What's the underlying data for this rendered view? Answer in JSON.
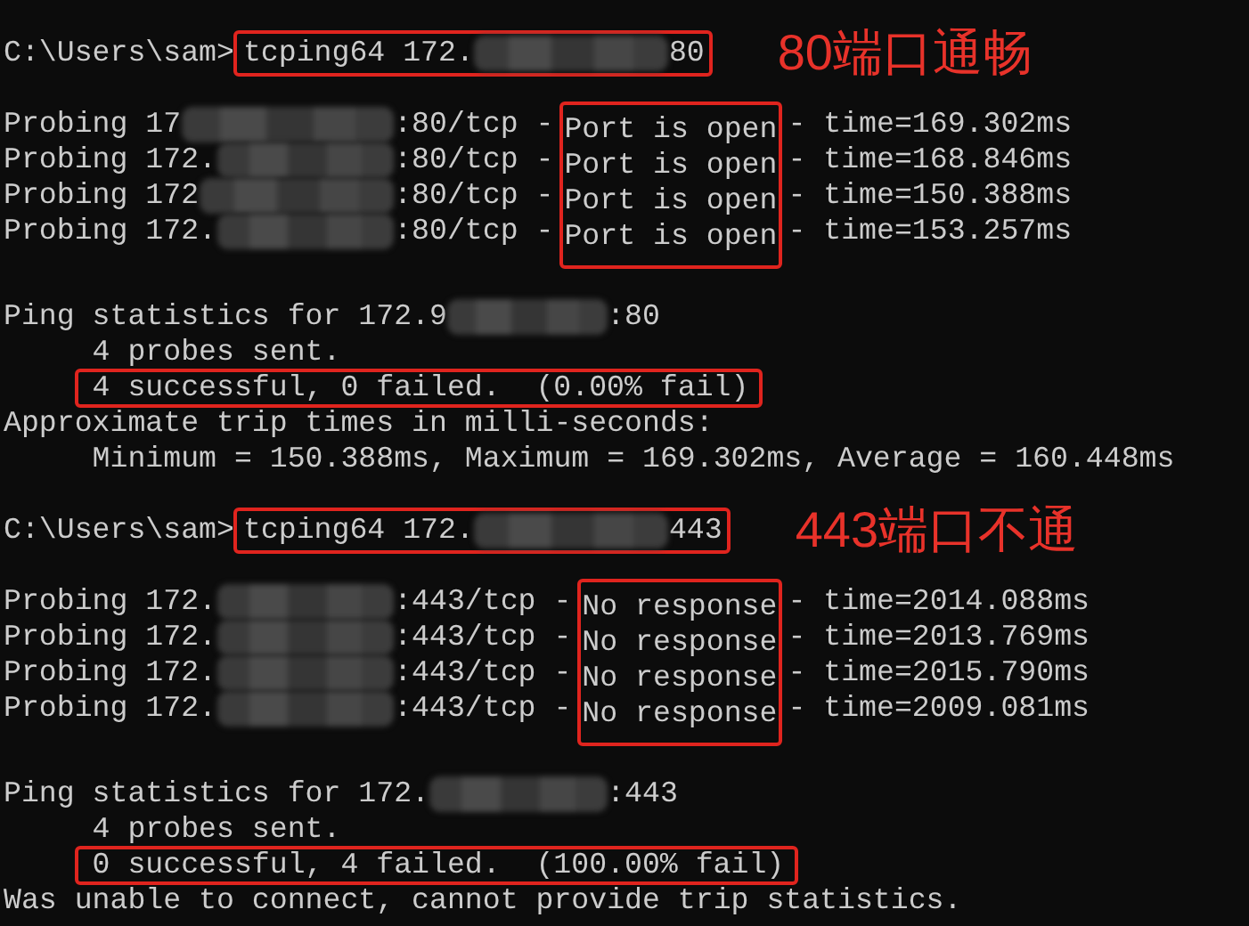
{
  "sections": [
    {
      "command": {
        "prompt": "C:\\Users\\sam>",
        "before_blur": "tcping64 172.",
        "after_blur": "80"
      },
      "annotation": "80端口通畅",
      "probes": [
        {
          "before_blur": "Probing 17",
          "after_blur": ":80/tcp -",
          "status": "Port is open",
          "time": "- time=169.302ms"
        },
        {
          "before_blur": "Probing 172.",
          "after_blur": ":80/tcp -",
          "status": "Port is open",
          "time": "- time=168.846ms"
        },
        {
          "before_blur": "Probing 172",
          "after_blur": ":80/tcp -",
          "status": "Port is open",
          "time": "- time=150.388ms"
        },
        {
          "before_blur": "Probing 172.",
          "after_blur": ":80/tcp -",
          "status": "Port is open",
          "time": "- time=153.257ms"
        }
      ],
      "statistics": {
        "before_blur": "Ping statistics for 172.9",
        "after_blur": ":80",
        "sent": "4 probes sent.",
        "result": "4 successful, 0 failed.  (0.00% fail)",
        "summary": [
          "Approximate trip times in milli-seconds:",
          "     Minimum = 150.388ms, Maximum = 169.302ms, Average = 160.448ms"
        ]
      }
    },
    {
      "command": {
        "prompt": "C:\\Users\\sam>",
        "before_blur": "tcping64 172.",
        "after_blur": "443"
      },
      "annotation": "443端口不通",
      "probes": [
        {
          "before_blur": "Probing 172.",
          "after_blur": ":443/tcp -",
          "status": "No response",
          "time": "- time=2014.088ms"
        },
        {
          "before_blur": "Probing 172.",
          "after_blur": ":443/tcp -",
          "status": "No response",
          "time": "- time=2013.769ms"
        },
        {
          "before_blur": "Probing 172.",
          "after_blur": ":443/tcp -",
          "status": "No response",
          "time": "- time=2015.790ms"
        },
        {
          "before_blur": "Probing 172.",
          "after_blur": ":443/tcp -",
          "status": "No response",
          "time": "- time=2009.081ms"
        }
      ],
      "statistics": {
        "before_blur": "Ping statistics for 172.",
        "after_blur": ":443",
        "sent": "4 probes sent.",
        "result": "0 successful, 4 failed.  (100.00% fail)",
        "summary": [
          "Was unable to connect, cannot provide trip statistics."
        ]
      }
    }
  ]
}
